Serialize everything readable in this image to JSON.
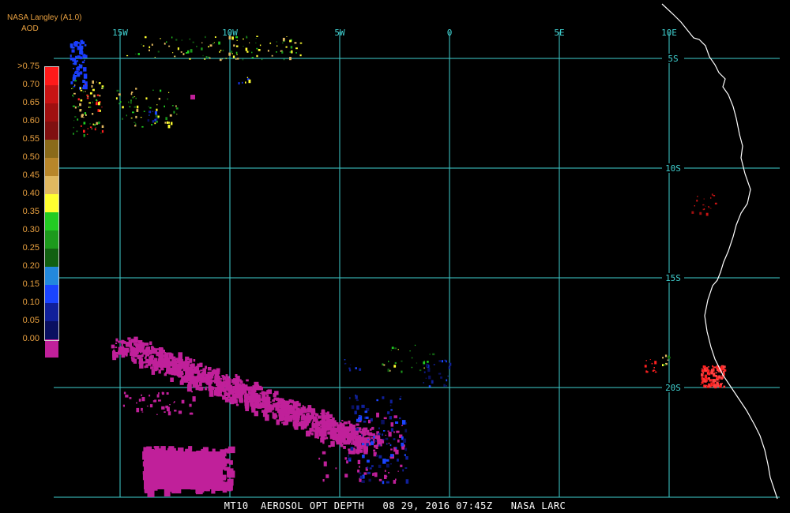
{
  "header": {
    "source": "NASA Langley (A1.0)",
    "product": "AOD"
  },
  "legend": {
    "labels": [
      ">0.75",
      "0.70",
      "0.65",
      "0.60",
      "0.55",
      "0.50",
      "0.45",
      "0.40",
      "0.35",
      "0.30",
      "0.25",
      "0.20",
      "0.15",
      "0.10",
      "0.05",
      "0.00"
    ],
    "colors": [
      "#ff1a1a",
      "#c81414",
      "#a01010",
      "#801010",
      "#8a6a1a",
      "#b8862a",
      "#e0b860",
      "#ffff30",
      "#22cc22",
      "#1c9a1c",
      "#116011",
      "#2288dd",
      "#1a44ff",
      "#10209a",
      "#0a1060",
      "#c0209a"
    ]
  },
  "grid": {
    "color": "#40d0d0",
    "lon_labels": [
      "15W",
      "10W",
      "5W",
      "0",
      "5E",
      "10E"
    ],
    "lat_labels": [
      "5S",
      "10S",
      "15S",
      "20S"
    ]
  },
  "footer": {
    "text": "MT10  AEROSOL OPT DEPTH   08 29, 2016 07:45Z   NASA LARC"
  },
  "colors": {
    "coast": "#ffffff",
    "low_aod": "#c0209a",
    "blue": "#1a3aff",
    "red": "#ff2020",
    "green": "#80ff40"
  }
}
